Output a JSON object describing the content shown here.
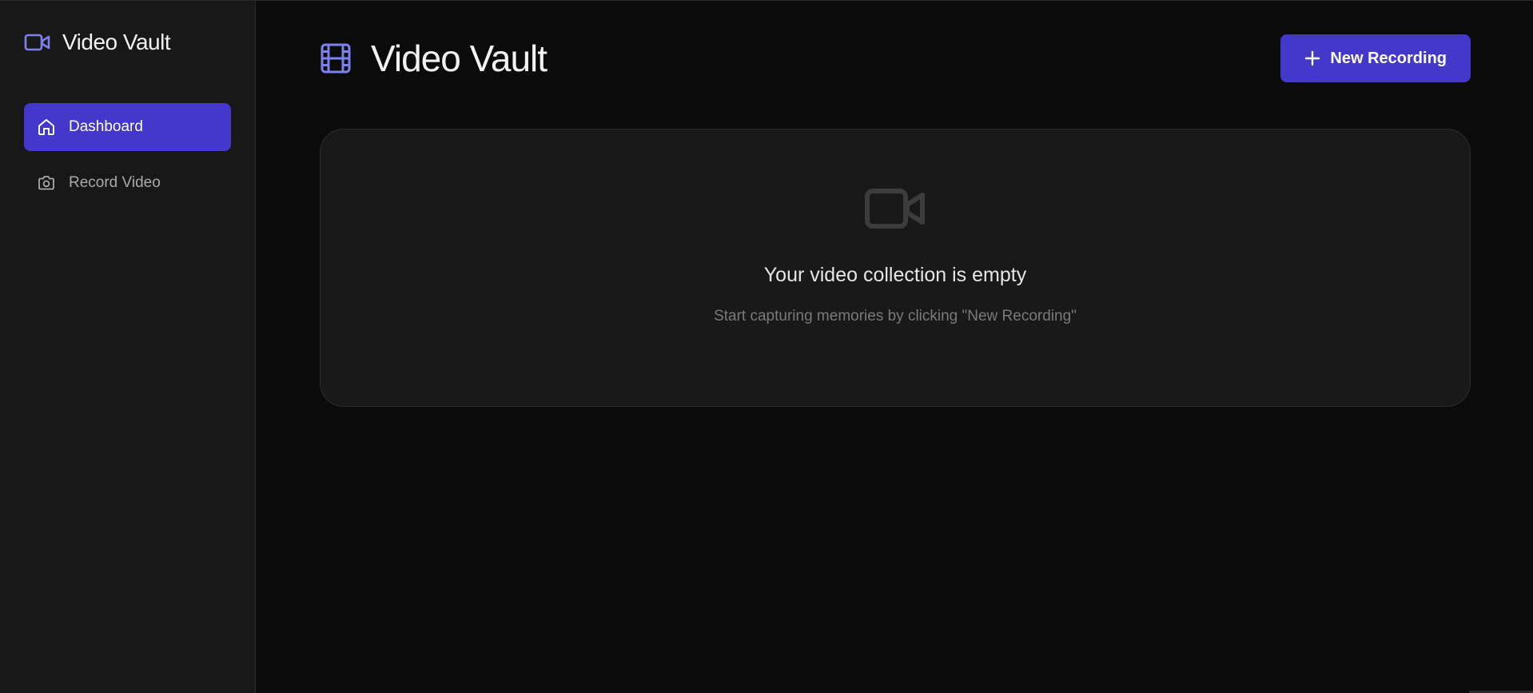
{
  "app": {
    "title": "Video Vault"
  },
  "sidebar": {
    "brand_icon": "video-camera-icon",
    "items": [
      {
        "label": "Dashboard",
        "icon": "home-icon",
        "active": true
      },
      {
        "label": "Record Video",
        "icon": "camera-icon",
        "active": false
      }
    ]
  },
  "header": {
    "title": "Video Vault",
    "icon": "film-icon",
    "new_button_label": "New Recording",
    "new_button_icon": "plus-icon"
  },
  "empty_state": {
    "icon": "video-camera-icon",
    "title": "Your video collection is empty",
    "subtitle": "Start capturing memories by clicking \"New Recording\""
  },
  "colors": {
    "accent": "#4338ca",
    "icon_accent": "#7b83eb",
    "background": "#0b0b0b",
    "sidebar": "#181818",
    "card": "#191919"
  }
}
